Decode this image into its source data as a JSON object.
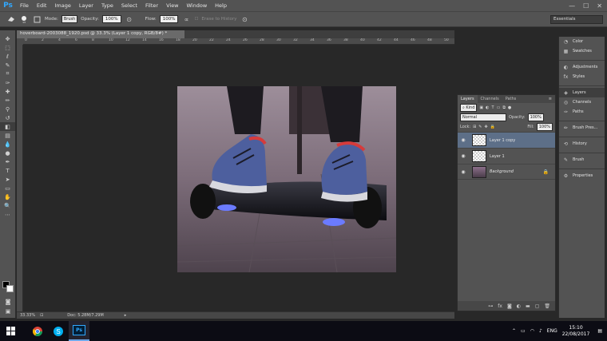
{
  "app": {
    "logo": "Ps"
  },
  "menu": [
    "File",
    "Edit",
    "Image",
    "Layer",
    "Type",
    "Select",
    "Filter",
    "View",
    "Window",
    "Help"
  ],
  "window_controls": {
    "minimize": "—",
    "maximize": "☐",
    "close": "✕"
  },
  "options": {
    "mode_label": "Mode:",
    "mode_value": "Brush",
    "opacity_label": "Opacity:",
    "opacity_value": "100%",
    "flow_label": "Flow:",
    "flow_value": "100%",
    "erase_history": "Erase to History",
    "workspace": "Essentials"
  },
  "document": {
    "tab_title": "hoverboard-2003088_1920.psd @ 33.3% (Layer 1 copy, RGB/8#) *",
    "zoom": "33.33%",
    "doc_size": "Doc: 5.28M/7.29M"
  },
  "ruler_ticks": [
    "0",
    "2",
    "4",
    "6",
    "8",
    "10",
    "12",
    "14",
    "16",
    "18",
    "20",
    "22",
    "24",
    "26",
    "28",
    "30",
    "32",
    "34",
    "36",
    "38",
    "40",
    "42",
    "44",
    "46",
    "48",
    "50"
  ],
  "layers_panel": {
    "tabs": [
      "Layers",
      "Channels",
      "Paths"
    ],
    "kind_label": "Kind",
    "blend_mode": "Normal",
    "opacity_label": "Opacity:",
    "opacity_value": "100%",
    "lock_label": "Lock:",
    "fill_label": "Fill:",
    "fill_value": "100%",
    "layers": [
      {
        "name": "Layer 1 copy",
        "selected": true
      },
      {
        "name": "Layer 1",
        "selected": false
      },
      {
        "name": "Background",
        "selected": false,
        "locked": true
      }
    ]
  },
  "dock": [
    {
      "label": "Color",
      "icon": "color-icon"
    },
    {
      "label": "Swatches",
      "icon": "swatches-icon"
    },
    {
      "label": "Adjustments",
      "icon": "adjustments-icon"
    },
    {
      "label": "Styles",
      "icon": "styles-icon"
    },
    {
      "label": "Layers",
      "icon": "layers-icon"
    },
    {
      "label": "Channels",
      "icon": "channels-icon"
    },
    {
      "label": "Paths",
      "icon": "paths-icon"
    },
    {
      "label": "Brush Pres...",
      "icon": "brush-presets-icon"
    },
    {
      "label": "History",
      "icon": "history-icon"
    },
    {
      "label": "Brush",
      "icon": "brush-icon"
    },
    {
      "label": "Properties",
      "icon": "properties-icon"
    }
  ],
  "taskbar": {
    "language": "ENG",
    "time": "15:10",
    "date": "22/08/2017",
    "ps_label": "Ps"
  },
  "colors": {
    "accent": "#31a8ff",
    "selected_layer": "#5d6f88"
  }
}
